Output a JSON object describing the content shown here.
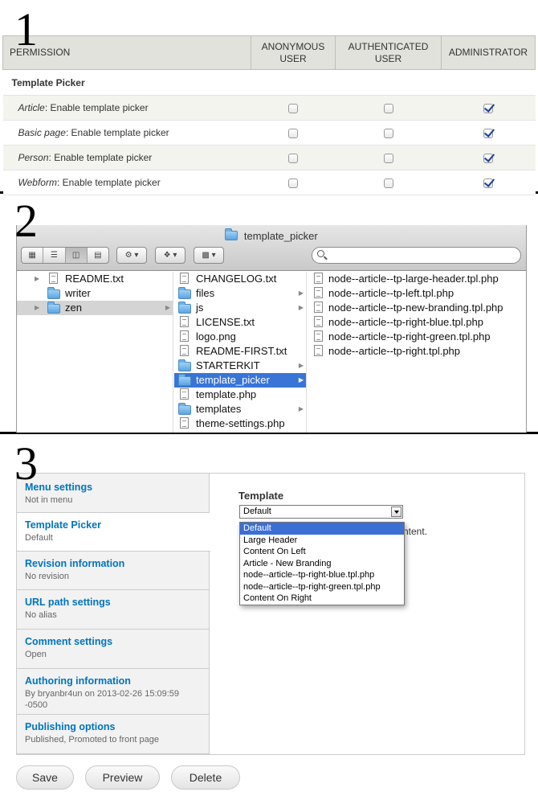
{
  "labels": {
    "one": "1",
    "two": "2",
    "three": "3"
  },
  "permissions": {
    "headers": {
      "permission": "PERMISSION",
      "anonymous": "ANONYMOUS USER",
      "authenticated": "AUTHENTICATED USER",
      "administrator": "ADMINISTRATOR"
    },
    "module": "Template Picker",
    "rows": [
      {
        "type": "Article",
        "suffix": ": Enable template picker",
        "anonymous": false,
        "authenticated": false,
        "administrator": true
      },
      {
        "type": "Basic page",
        "suffix": ": Enable template picker",
        "anonymous": false,
        "authenticated": false,
        "administrator": true
      },
      {
        "type": "Person",
        "suffix": ": Enable template picker",
        "anonymous": false,
        "authenticated": false,
        "administrator": true
      },
      {
        "type": "Webform",
        "suffix": ": Enable template picker",
        "anonymous": false,
        "authenticated": false,
        "administrator": true
      }
    ]
  },
  "finder": {
    "title": "template_picker",
    "search_placeholder": "",
    "col1": [
      {
        "name": "README.txt",
        "icon": "document-icon",
        "arrow": false,
        "disclosure": true
      },
      {
        "name": "writer",
        "icon": "folder-alias-icon",
        "arrow": false,
        "disclosure": false
      },
      {
        "name": "zen",
        "icon": "folder-icon",
        "arrow": true,
        "disclosure": true,
        "selected": "grey"
      }
    ],
    "col2": [
      {
        "name": "CHANGELOG.txt",
        "icon": "document-icon",
        "arrow": false
      },
      {
        "name": "files",
        "icon": "folder-icon",
        "arrow": true
      },
      {
        "name": "js",
        "icon": "folder-icon",
        "arrow": true
      },
      {
        "name": "LICENSE.txt",
        "icon": "document-icon",
        "arrow": false
      },
      {
        "name": "logo.png",
        "icon": "image-icon",
        "arrow": false
      },
      {
        "name": "README-FIRST.txt",
        "icon": "document-icon",
        "arrow": false
      },
      {
        "name": "STARTERKIT",
        "icon": "folder-icon",
        "arrow": true
      },
      {
        "name": "template_picker",
        "icon": "folder-icon",
        "arrow": true,
        "selected": "blue"
      },
      {
        "name": "template.php",
        "icon": "document-icon",
        "arrow": false
      },
      {
        "name": "templates",
        "icon": "folder-icon",
        "arrow": true
      },
      {
        "name": "theme-settings.php",
        "icon": "document-icon",
        "arrow": false
      }
    ],
    "col3": [
      {
        "name": "node--article--tp-large-header.tpl.php",
        "icon": "document-icon"
      },
      {
        "name": "node--article--tp-left.tpl.php",
        "icon": "document-icon"
      },
      {
        "name": "node--article--tp-new-branding.tpl.php",
        "icon": "document-icon"
      },
      {
        "name": "node--article--tp-right-blue.tpl.php",
        "icon": "document-icon"
      },
      {
        "name": "node--article--tp-right-green.tpl.php",
        "icon": "document-icon"
      },
      {
        "name": "node--article--tp-right.tpl.php",
        "icon": "document-icon"
      }
    ]
  },
  "vertical_tabs": [
    {
      "title": "Menu settings",
      "summary": "Not in menu"
    },
    {
      "title": "Template Picker",
      "summary": "Default",
      "active": true
    },
    {
      "title": "Revision information",
      "summary": "No revision"
    },
    {
      "title": "URL path settings",
      "summary": "No alias"
    },
    {
      "title": "Comment settings",
      "summary": "Open"
    },
    {
      "title": "Authoring information",
      "summary": "By bryanbr4un on 2013-02-26 15:09:59 -0500"
    },
    {
      "title": "Publishing options",
      "summary": "Published, Promoted to front page"
    }
  ],
  "template_field": {
    "label": "Template",
    "value": "Default",
    "description_fragment": "ntent.",
    "options": [
      "Default",
      "Large Header",
      "Content On Left",
      "Article - New Branding",
      "node--article--tp-right-blue.tpl.php",
      "node--article--tp-right-green.tpl.php",
      "Content On Right"
    ]
  },
  "buttons": {
    "save": "Save",
    "preview": "Preview",
    "delete": "Delete"
  }
}
